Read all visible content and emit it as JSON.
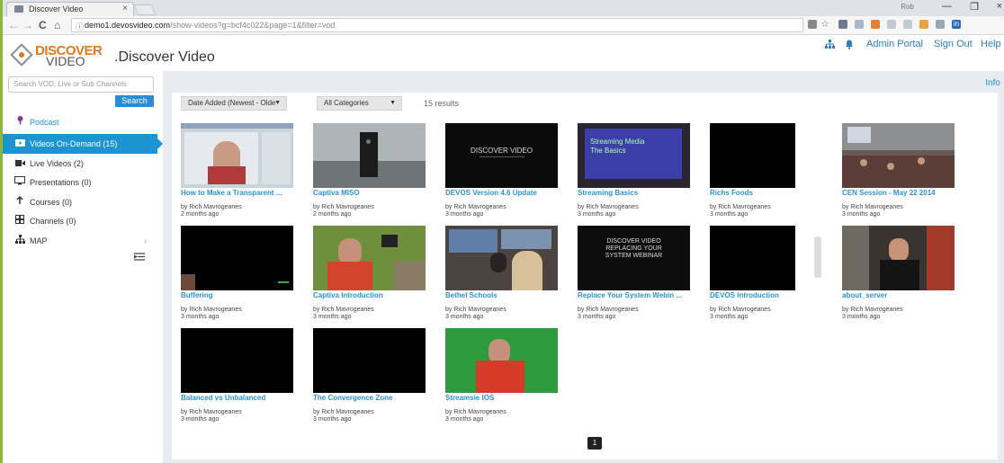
{
  "browser": {
    "tab_title": "Discover Video",
    "tab_close": "×",
    "url_host": "demo1.devosvideo.com",
    "url_path": "/show-videos?g=bcf4c022&page=1&filter=vod",
    "url_info": "ⓘ",
    "user_label": "Rob",
    "back": "←",
    "forward": "→",
    "reload": "C",
    "home": "⌂",
    "minimize": "—",
    "restore": "❐",
    "close": "×"
  },
  "header": {
    "logo_top": "DISCOVER",
    "logo_bottom": "VIDEO",
    "site_title": ".Discover Video",
    "admin_portal": "Admin Portal",
    "sign_out": "Sign Out",
    "help": "Help"
  },
  "sidebar": {
    "search_placeholder": "Search VOD, Live or Sub Channels",
    "search_button": "Search",
    "items": [
      {
        "label": "Podcast",
        "icon": "podcast-icon"
      },
      {
        "label": "Videos On-Demand (15)",
        "icon": "video-icon"
      },
      {
        "label": "Live Videos (2)",
        "icon": "camera-icon"
      },
      {
        "label": "Presentations (0)",
        "icon": "monitor-icon"
      },
      {
        "label": "Courses (0)",
        "icon": "course-icon"
      },
      {
        "label": "Channels (0)",
        "icon": "grid-icon"
      },
      {
        "label": "MAP",
        "icon": "sitemap-icon"
      }
    ],
    "map_chevron": "›"
  },
  "main": {
    "info": "Info",
    "sort": "Date Added (Newest - Olde",
    "category": "All Categories",
    "results": "15 results",
    "page": "1"
  },
  "videos": [
    {
      "title": "How to Make a Transparent ...",
      "author": "by Rich Mavrogeanes",
      "date": "2 months ago"
    },
    {
      "title": "Captiva MISO",
      "author": "by Rich Mavrogeanes",
      "date": "2 months ago"
    },
    {
      "title": "DEVOS Version 4.6 Update",
      "author": "by Rich Mavrogeanes",
      "date": "3 months ago",
      "overlay": "DISCOVER VIDEO"
    },
    {
      "title": "Streaming Basics",
      "author": "by Rich Mavrogeanes",
      "date": "3 months ago",
      "overlay": "Streaming Media The Basics"
    },
    {
      "title": "Richs Foods",
      "author": "by Rich Mavrogeanes",
      "date": "3 months ago"
    },
    {
      "title": "CEN Session - May 22 2014",
      "author": "by Rich Mavrogeanes",
      "date": "3 months ago"
    },
    {
      "title": "Buffering",
      "author": "by Rich Mavrogeanes",
      "date": "3 months ago"
    },
    {
      "title": "Captiva Introduction",
      "author": "by Rich Mavrogeanes",
      "date": "3 months ago"
    },
    {
      "title": "Bethel Schools",
      "author": "by Rich Mavrogeanes",
      "date": "3 months ago"
    },
    {
      "title": "Replace Your System Webin ...",
      "author": "by Rich Mavrogeanes",
      "date": "3 months ago",
      "overlay": "DISCOVER VIDEO REPLACING YOUR SYSTEM WEBINAR"
    },
    {
      "title": "DEVOS Introduction",
      "author": "by Rich Mavrogeanes",
      "date": "3 months ago"
    },
    {
      "title": "about_server",
      "author": "by Rich Mavrogeanes",
      "date": "3 months ago"
    },
    {
      "title": "Balanced vs Unbalanced",
      "author": "by Rich Mavrogeanes",
      "date": "3 months ago"
    },
    {
      "title": "The Convergence Zone",
      "author": "by Rich Mavrogeanes",
      "date": "3 months ago"
    },
    {
      "title": "Streamsie IOS",
      "author": "by Rich Mavrogeanes",
      "date": "3 months ago"
    }
  ],
  "colors": {
    "accent": "#1d94d2",
    "link": "#2a93d5",
    "brand_orange": "#e07a1f",
    "desktop_green": "#8cb63c"
  }
}
